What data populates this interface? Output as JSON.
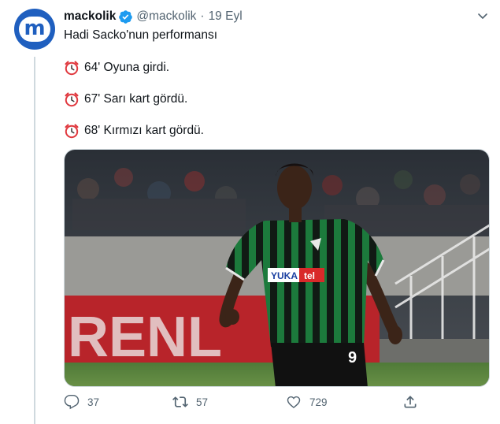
{
  "tweet": {
    "author_name": "mackolik",
    "handle": "@mackolik",
    "separator": "·",
    "date": "19 Eyl",
    "text": "Hadi Sacko'nun performansı",
    "events": [
      {
        "icon": "alarm-clock-icon",
        "text": "64' Oyuna girdi."
      },
      {
        "icon": "alarm-clock-icon",
        "text": "67' Sarı kart gördü."
      },
      {
        "icon": "alarm-clock-icon",
        "text": "68' Kırmızı kart gördü."
      }
    ],
    "avatar_letter": "m",
    "media": {
      "jersey_sponsor_a": "YUKA",
      "jersey_sponsor_b": "tel",
      "jersey_number": "9",
      "board_text": "RENL"
    }
  },
  "actions": {
    "replies": "37",
    "retweets": "57",
    "likes": "729"
  },
  "colors": {
    "brand_blue": "#1f5fbf",
    "verified_blue": "#1d9bf0",
    "muted_text": "#536471",
    "jersey_green": "#1c7a3c"
  }
}
